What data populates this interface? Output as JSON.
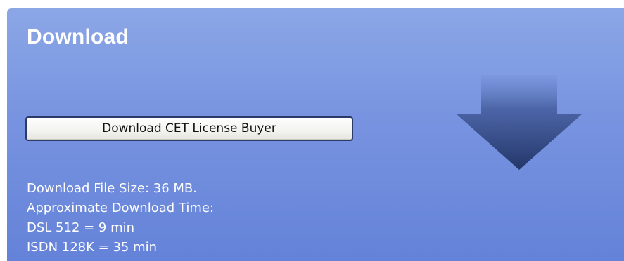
{
  "download": {
    "title": "Download",
    "button_label": "Download CET License Buyer",
    "icon": "download-arrow-icon",
    "info": {
      "file_size": "Download File Size: 36 MB.",
      "time_heading": "Approximate Download Time:",
      "dsl": "DSL 512 = 9 min",
      "isdn": "ISDN 128K = 35 min"
    }
  },
  "colors": {
    "panel_top": "#8ba7e6",
    "panel_bottom": "#6482d8",
    "arrow_light": "#6f8cd6",
    "arrow_dark": "#2a3e70",
    "text": "#ffffff"
  }
}
